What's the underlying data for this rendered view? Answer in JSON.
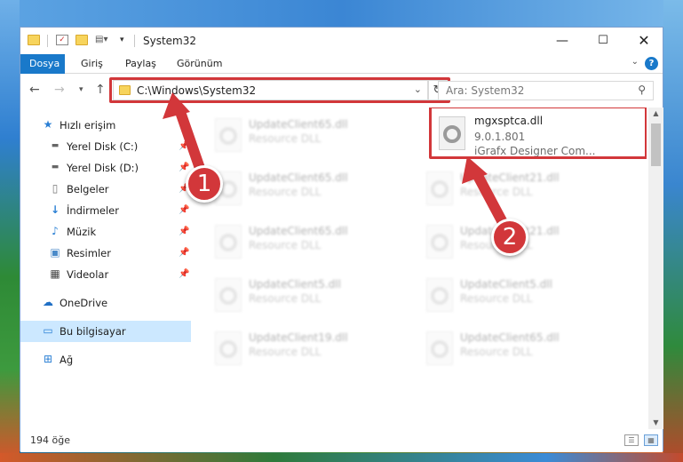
{
  "window": {
    "title": "System32"
  },
  "ribbon": {
    "tabs": [
      "Dosya",
      "Giriş",
      "Paylaş",
      "Görünüm"
    ]
  },
  "address": {
    "path": "C:\\Windows\\System32",
    "search_placeholder": "Ara: System32"
  },
  "sidebar": {
    "items": [
      {
        "label": "Hızlı erişim",
        "icon": "star-icon",
        "pinned": false
      },
      {
        "label": "Yerel Disk (C:)",
        "icon": "drive-icon",
        "pinned": true
      },
      {
        "label": "Yerel Disk (D:)",
        "icon": "drive-icon",
        "pinned": true
      },
      {
        "label": "Belgeler",
        "icon": "documents-icon",
        "pinned": true
      },
      {
        "label": "İndirmeler",
        "icon": "download-icon",
        "pinned": true
      },
      {
        "label": "Müzik",
        "icon": "music-icon",
        "pinned": true
      },
      {
        "label": "Resimler",
        "icon": "pictures-icon",
        "pinned": true
      },
      {
        "label": "Videolar",
        "icon": "videos-icon",
        "pinned": true
      },
      {
        "label": "OneDrive",
        "icon": "cloud-icon",
        "pinned": false
      },
      {
        "label": "Bu bilgisayar",
        "icon": "computer-icon",
        "pinned": false,
        "selected": true
      },
      {
        "label": "Ağ",
        "icon": "network-icon",
        "pinned": false
      }
    ]
  },
  "files": {
    "highlighted": {
      "name": "mgxsptca.dll",
      "version": "9.0.1.801",
      "company": "iGrafx Designer Com..."
    },
    "left_column": [
      {
        "name": "UpdateClient65.dll",
        "type": "Resource DLL"
      },
      {
        "name": "UpdateClient65.dll",
        "type": "Resource DLL"
      },
      {
        "name": "UpdateClient65.dll",
        "type": "Resource DLL"
      },
      {
        "name": "UpdateClient5.dll",
        "type": "Resource DLL"
      },
      {
        "name": "UpdateClient19.dll",
        "type": "Resource DLL"
      }
    ],
    "right_column": [
      {
        "name": "UpdateClient21.dll",
        "type": "Resource DLL"
      },
      {
        "name": "UpdateClient21.dll",
        "type": "Resource DLL"
      },
      {
        "name": "UpdateClient5.dll",
        "type": "Resource DLL"
      },
      {
        "name": "UpdateClient65.dll",
        "type": "Resource DLL"
      }
    ]
  },
  "status": {
    "item_count": "194 öğe"
  },
  "callouts": {
    "one": "1",
    "two": "2",
    "color": "#d2373a"
  },
  "colors": {
    "accent": "#1979ca",
    "selection": "#cce8ff"
  }
}
